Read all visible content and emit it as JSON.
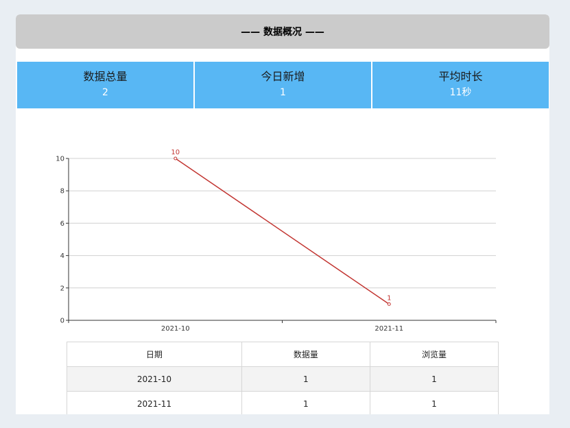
{
  "header": {
    "title": "—— 数据概况 ——"
  },
  "stats": [
    {
      "label": "数据总量",
      "value": "2"
    },
    {
      "label": "今日新增",
      "value": "1"
    },
    {
      "label": "平均时长",
      "value": "11秒"
    }
  ],
  "chart_data": {
    "type": "line",
    "categories": [
      "2021-10",
      "2021-11"
    ],
    "series": [
      {
        "values": [
          10,
          1
        ],
        "color": "#c23531"
      }
    ],
    "ylim": [
      0,
      10
    ],
    "yticks": [
      0,
      2,
      4,
      6,
      8,
      10
    ],
    "grid": true,
    "title": "",
    "xlabel": "",
    "ylabel": ""
  },
  "table": {
    "headers": [
      "日期",
      "数据量",
      "浏览量"
    ],
    "rows": [
      [
        "2021-10",
        "1",
        "1"
      ],
      [
        "2021-11",
        "1",
        "1"
      ]
    ]
  }
}
